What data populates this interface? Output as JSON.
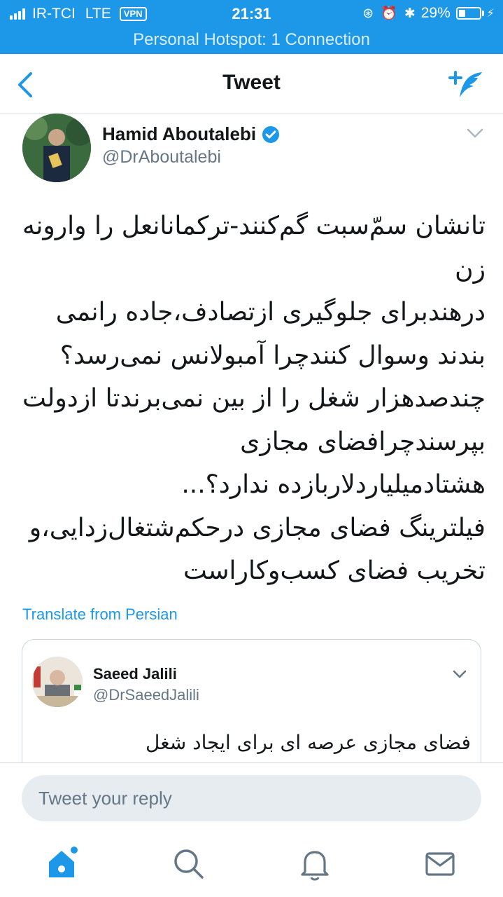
{
  "status_bar": {
    "carrier": "IR-TCI",
    "network": "LTE",
    "vpn": "VPN",
    "time": "21:31",
    "battery": "29%",
    "hotspot": "Personal Hotspot: 1 Connection"
  },
  "nav": {
    "title": "Tweet"
  },
  "tweet": {
    "author_name": "Hamid Aboutalebi",
    "author_handle": "@DrAboutalebi",
    "text_lines": [
      "تانشان سمّ‌سبت گم‌کنند-ترکمانانعل را وارونه",
      "زن",
      "درهندبرای جلوگیری ازتصادف،جاده رانمی",
      "بندند وسوال کنندچرا آمبولانس نمی‌رسد؟",
      "چندصدهزار شغل را از بین نمی‌برندتا ازدولت",
      "بپرسندچرافضای مجازی",
      "هشتادمیلیاردلاربازده ندارد؟...",
      "فیلترینگ فضای مجازی درحکم‌شتغال‌زدایی،و",
      "تخریب فضای کسب‌وکاراست"
    ],
    "translate_label": "Translate from Persian"
  },
  "quote": {
    "author_name": "Saeed Jalili",
    "author_handle": "@DrSaeedJalili",
    "text": "فضای مجازی عرصه ای برای ایجاد شغل"
  },
  "reply": {
    "placeholder": "Tweet your reply"
  },
  "tabs": [
    "home-icon",
    "search-icon",
    "notifications-icon",
    "messages-icon"
  ],
  "colors": {
    "accent": "#1d97e8",
    "secondary_text": "#657786"
  }
}
